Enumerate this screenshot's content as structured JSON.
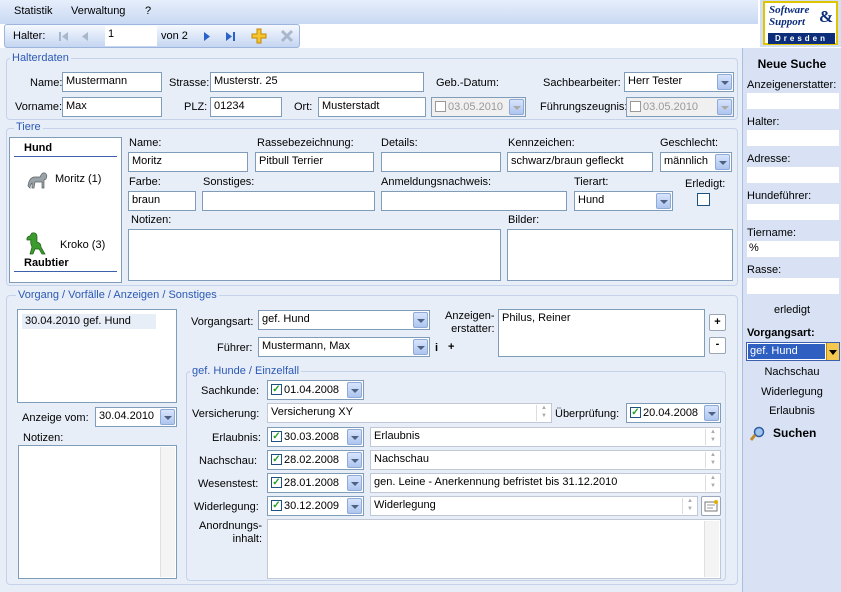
{
  "menu": {
    "statistik": "Statistik",
    "verwaltung": "Verwaltung",
    "help": "?"
  },
  "toolbar": {
    "halter_label": "Halter:",
    "record": "1",
    "of_total": "von 2"
  },
  "logo": {
    "line1": "Software",
    "line2": "Support",
    "amp": "&",
    "line3": "Dresden"
  },
  "halterdaten": {
    "legend": "Halterdaten",
    "name_label": "Name:",
    "name": "Mustermann",
    "vorname_label": "Vorname:",
    "vorname": "Max",
    "strasse_label": "Strasse:",
    "strasse": "Musterstr. 25",
    "plz_label": "PLZ:",
    "plz": "01234",
    "ort_label": "Ort:",
    "ort": "Musterstadt",
    "geb_label": "Geb.-Datum:",
    "geb_date": "03.05.2010",
    "sachbearbeiter_label": "Sachbearbeiter:",
    "sachbearbeiter": "Herr Tester",
    "fz_label": "Führungszeugnis:",
    "fz_date": "03.05.2010"
  },
  "tiere": {
    "legend": "Tiere",
    "group1": "Hund",
    "animal1": "Moritz (1)",
    "group2": "Raubtier",
    "animal2": "Kroko (3)",
    "name_label": "Name:",
    "name": "Moritz",
    "rasse_label": "Rassebezeichnung:",
    "rasse": "Pitbull Terrier",
    "details_label": "Details:",
    "details": "",
    "kennzeichen_label": "Kennzeichen:",
    "kennzeichen": "schwarz/braun gefleckt",
    "geschlecht_label": "Geschlecht:",
    "geschlecht": "männlich",
    "farbe_label": "Farbe:",
    "farbe": "braun",
    "sonstiges_label": "Sonstiges:",
    "anmeldung_label": "Anmeldungsnachweis:",
    "tierart_label": "Tierart:",
    "tierart": "Hund",
    "erledigt_label": "Erledigt:",
    "notizen_label": "Notizen:",
    "bilder_label": "Bilder:"
  },
  "vorgang": {
    "legend": "Vorgang / Vorfälle / Anzeigen / Sonstiges",
    "list_item": "30.04.2010 gef. Hund",
    "anzeige_label": "Anzeige vom:",
    "anzeige_date": "30.04.2010",
    "notizen_label": "Notizen:",
    "vorgangsart_label": "Vorgangsart:",
    "vorgangsart": "gef. Hund",
    "fuehrer_label": "Führer:",
    "fuehrer": "Mustermann, Max",
    "i_glyph": "i",
    "plus_glyph": "+",
    "erstatter_label1": "Anzeigen-",
    "erstatter_label2": "erstatter:",
    "erstatter": "Philus, Reiner",
    "sub_legend": "gef. Hunde / Einzelfall",
    "sachkunde_label": "Sachkunde:",
    "sachkunde_date": "01.04.2008",
    "versicherung_label": "Versicherung:",
    "versicherung": "Versicherung XY",
    "ueberpruefung_label": "Überprüfung:",
    "ueberpruefung_date": "20.04.2008",
    "erlaubnis_label": "Erlaubnis:",
    "erlaubnis_date": "30.03.2008",
    "erlaubnis_text": "Erlaubnis",
    "nachschau_label": "Nachschau:",
    "nachschau_date": "28.02.2008",
    "nachschau_text": "Nachschau",
    "wesenstest_label": "Wesenstest:",
    "wesenstest_date": "28.01.2008",
    "wesenstest_text": "gen. Leine - Anerkennung befristet bis 31.12.2010",
    "widerlegung_label": "Widerlegung:",
    "widerlegung_date": "30.12.2009",
    "widerlegung_text": "Widerlegung",
    "anordnung_label1": "Anordnungs-",
    "anordnung_label2": "inhalt:"
  },
  "sidebar": {
    "title": "Neue Suche",
    "anzeigenerstatter": "Anzeigenerstatter:",
    "halter": "Halter:",
    "adresse": "Adresse:",
    "hundefuehrer": "Hundeführer:",
    "tiername": "Tiername:",
    "tiername_value": "%",
    "rasse": "Rasse:",
    "erledigt": "erledigt",
    "vorgangsart": "Vorgangsart:",
    "vorgangsart_value": "gef. Hund",
    "nachschau": "Nachschau",
    "widerlegung": "Widerlegung",
    "erlaubnis": "Erlaubnis",
    "suchen": "Suchen"
  }
}
